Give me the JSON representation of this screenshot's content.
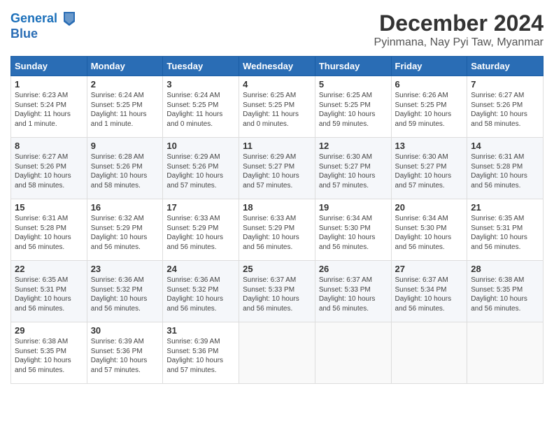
{
  "header": {
    "logo_line1": "General",
    "logo_line2": "Blue",
    "month_title": "December 2024",
    "location": "Pyinmana, Nay Pyi Taw, Myanmar"
  },
  "weekdays": [
    "Sunday",
    "Monday",
    "Tuesday",
    "Wednesday",
    "Thursday",
    "Friday",
    "Saturday"
  ],
  "weeks": [
    [
      {
        "day": "1",
        "content": "Sunrise: 6:23 AM\nSunset: 5:24 PM\nDaylight: 11 hours and 1 minute."
      },
      {
        "day": "2",
        "content": "Sunrise: 6:24 AM\nSunset: 5:25 PM\nDaylight: 11 hours and 1 minute."
      },
      {
        "day": "3",
        "content": "Sunrise: 6:24 AM\nSunset: 5:25 PM\nDaylight: 11 hours and 0 minutes."
      },
      {
        "day": "4",
        "content": "Sunrise: 6:25 AM\nSunset: 5:25 PM\nDaylight: 11 hours and 0 minutes."
      },
      {
        "day": "5",
        "content": "Sunrise: 6:25 AM\nSunset: 5:25 PM\nDaylight: 10 hours and 59 minutes."
      },
      {
        "day": "6",
        "content": "Sunrise: 6:26 AM\nSunset: 5:25 PM\nDaylight: 10 hours and 59 minutes."
      },
      {
        "day": "7",
        "content": "Sunrise: 6:27 AM\nSunset: 5:26 PM\nDaylight: 10 hours and 58 minutes."
      }
    ],
    [
      {
        "day": "8",
        "content": "Sunrise: 6:27 AM\nSunset: 5:26 PM\nDaylight: 10 hours and 58 minutes."
      },
      {
        "day": "9",
        "content": "Sunrise: 6:28 AM\nSunset: 5:26 PM\nDaylight: 10 hours and 58 minutes."
      },
      {
        "day": "10",
        "content": "Sunrise: 6:29 AM\nSunset: 5:26 PM\nDaylight: 10 hours and 57 minutes."
      },
      {
        "day": "11",
        "content": "Sunrise: 6:29 AM\nSunset: 5:27 PM\nDaylight: 10 hours and 57 minutes."
      },
      {
        "day": "12",
        "content": "Sunrise: 6:30 AM\nSunset: 5:27 PM\nDaylight: 10 hours and 57 minutes."
      },
      {
        "day": "13",
        "content": "Sunrise: 6:30 AM\nSunset: 5:27 PM\nDaylight: 10 hours and 57 minutes."
      },
      {
        "day": "14",
        "content": "Sunrise: 6:31 AM\nSunset: 5:28 PM\nDaylight: 10 hours and 56 minutes."
      }
    ],
    [
      {
        "day": "15",
        "content": "Sunrise: 6:31 AM\nSunset: 5:28 PM\nDaylight: 10 hours and 56 minutes."
      },
      {
        "day": "16",
        "content": "Sunrise: 6:32 AM\nSunset: 5:29 PM\nDaylight: 10 hours and 56 minutes."
      },
      {
        "day": "17",
        "content": "Sunrise: 6:33 AM\nSunset: 5:29 PM\nDaylight: 10 hours and 56 minutes."
      },
      {
        "day": "18",
        "content": "Sunrise: 6:33 AM\nSunset: 5:29 PM\nDaylight: 10 hours and 56 minutes."
      },
      {
        "day": "19",
        "content": "Sunrise: 6:34 AM\nSunset: 5:30 PM\nDaylight: 10 hours and 56 minutes."
      },
      {
        "day": "20",
        "content": "Sunrise: 6:34 AM\nSunset: 5:30 PM\nDaylight: 10 hours and 56 minutes."
      },
      {
        "day": "21",
        "content": "Sunrise: 6:35 AM\nSunset: 5:31 PM\nDaylight: 10 hours and 56 minutes."
      }
    ],
    [
      {
        "day": "22",
        "content": "Sunrise: 6:35 AM\nSunset: 5:31 PM\nDaylight: 10 hours and 56 minutes."
      },
      {
        "day": "23",
        "content": "Sunrise: 6:36 AM\nSunset: 5:32 PM\nDaylight: 10 hours and 56 minutes."
      },
      {
        "day": "24",
        "content": "Sunrise: 6:36 AM\nSunset: 5:32 PM\nDaylight: 10 hours and 56 minutes."
      },
      {
        "day": "25",
        "content": "Sunrise: 6:37 AM\nSunset: 5:33 PM\nDaylight: 10 hours and 56 minutes."
      },
      {
        "day": "26",
        "content": "Sunrise: 6:37 AM\nSunset: 5:33 PM\nDaylight: 10 hours and 56 minutes."
      },
      {
        "day": "27",
        "content": "Sunrise: 6:37 AM\nSunset: 5:34 PM\nDaylight: 10 hours and 56 minutes."
      },
      {
        "day": "28",
        "content": "Sunrise: 6:38 AM\nSunset: 5:35 PM\nDaylight: 10 hours and 56 minutes."
      }
    ],
    [
      {
        "day": "29",
        "content": "Sunrise: 6:38 AM\nSunset: 5:35 PM\nDaylight: 10 hours and 56 minutes."
      },
      {
        "day": "30",
        "content": "Sunrise: 6:39 AM\nSunset: 5:36 PM\nDaylight: 10 hours and 57 minutes."
      },
      {
        "day": "31",
        "content": "Sunrise: 6:39 AM\nSunset: 5:36 PM\nDaylight: 10 hours and 57 minutes."
      },
      {
        "day": "",
        "content": ""
      },
      {
        "day": "",
        "content": ""
      },
      {
        "day": "",
        "content": ""
      },
      {
        "day": "",
        "content": ""
      }
    ]
  ]
}
